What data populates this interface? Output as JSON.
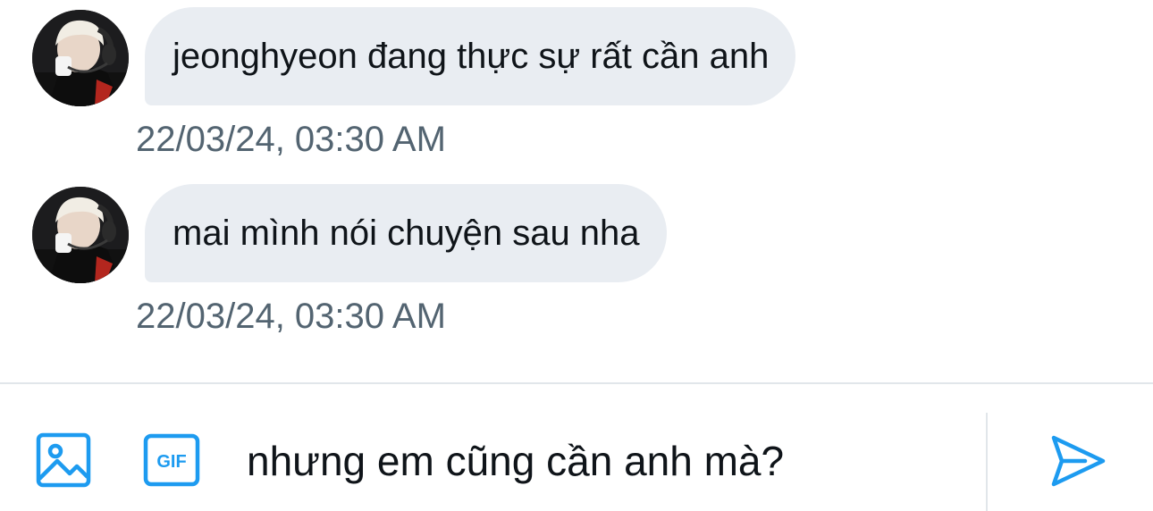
{
  "colors": {
    "accent": "#1d9bf0",
    "bubble_background": "#e9edf2",
    "timestamp_text": "#536471",
    "primary_text": "#0f1419",
    "divider": "#e1e6ea"
  },
  "conversation": {
    "messages": [
      {
        "text": "jeonghyeon đang thực sự rất cần anh",
        "timestamp": "22/03/24, 03:30 AM",
        "avatar_icon": "user-avatar-icon"
      },
      {
        "text": "mai mình nói chuyện sau nha",
        "timestamp": "22/03/24, 03:30 AM",
        "avatar_icon": "user-avatar-icon"
      }
    ]
  },
  "composer": {
    "media_icon": "image-icon",
    "gif_icon": "gif-icon",
    "gif_label": "GIF",
    "input_value": "nhưng em cũng cần anh mà?",
    "send_icon": "send-icon"
  }
}
